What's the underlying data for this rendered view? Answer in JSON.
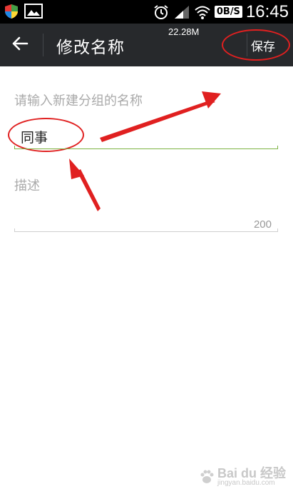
{
  "status_bar": {
    "net_speed": "0B/S",
    "time": "16:45",
    "icons": [
      "shield-icon",
      "image-icon",
      "alarm-clock-icon",
      "wifi-icon",
      "signal-icon"
    ]
  },
  "app_bar": {
    "title": "修改名称",
    "memory": "22.28M",
    "save_label": "保存",
    "back_icon": "back-arrow-icon"
  },
  "form": {
    "name": {
      "placeholder": "请输入新建分组的名称",
      "value": "同事"
    },
    "description": {
      "placeholder": "描述",
      "remaining": "200"
    }
  },
  "annotations": {
    "color": "#e02020"
  },
  "colors": {
    "app_bar": "#27292c",
    "active_underline": "#7cb342"
  },
  "watermark": {
    "logo_text": "Bai du 经验",
    "sub_text": "jingyan.baidu.com"
  }
}
